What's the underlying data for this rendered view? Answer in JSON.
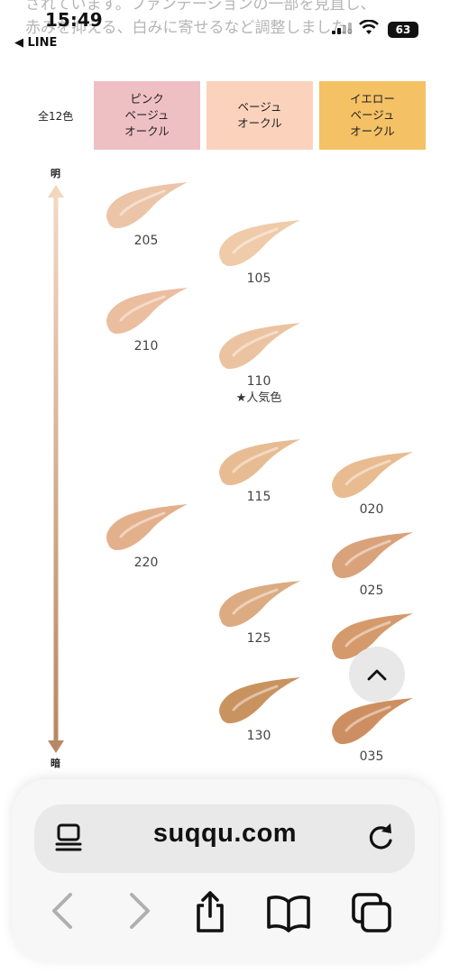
{
  "background_text": {
    "line1": "されています。ファンデーションの一部を見直し、",
    "line2": "赤みを抑える、白みに寄せるなど調整しました。"
  },
  "status_bar": {
    "time": "15:49",
    "back_app": "◀ LINE",
    "battery": "63"
  },
  "header": {
    "total_label": "全12色",
    "tones": [
      {
        "label": "ピンク\nベージュ\nオークル",
        "color": "#efc0c3"
      },
      {
        "label": "ベージュ\nオークル",
        "color": "#fbd3bd"
      },
      {
        "label": "イエロー\nベージュ\nオークル",
        "color": "#f4c165"
      }
    ]
  },
  "scale": {
    "top_label": "明",
    "bottom_label": "暗"
  },
  "shades": [
    {
      "code": "205",
      "color": "#ecc4a8"
    },
    {
      "code": "105",
      "color": "#efcba9"
    },
    {
      "code": "210",
      "color": "#ebbea0"
    },
    {
      "code": "110",
      "color": "#ecc3a1",
      "note": "★人気色"
    },
    {
      "code": "115",
      "color": "#e8bc93"
    },
    {
      "code": "020",
      "color": "#e8bb90"
    },
    {
      "code": "220",
      "color": "#e3b08c"
    },
    {
      "code": "025",
      "color": "#d9a27a"
    },
    {
      "code": "125",
      "color": "#dcab82"
    },
    {
      "code": "035",
      "color": "#cd8f62"
    },
    {
      "code": "130",
      "color": "#c9935f"
    },
    {
      "code": "",
      "color": "#d59a6c"
    }
  ],
  "browser": {
    "url": "suqqu.com"
  }
}
